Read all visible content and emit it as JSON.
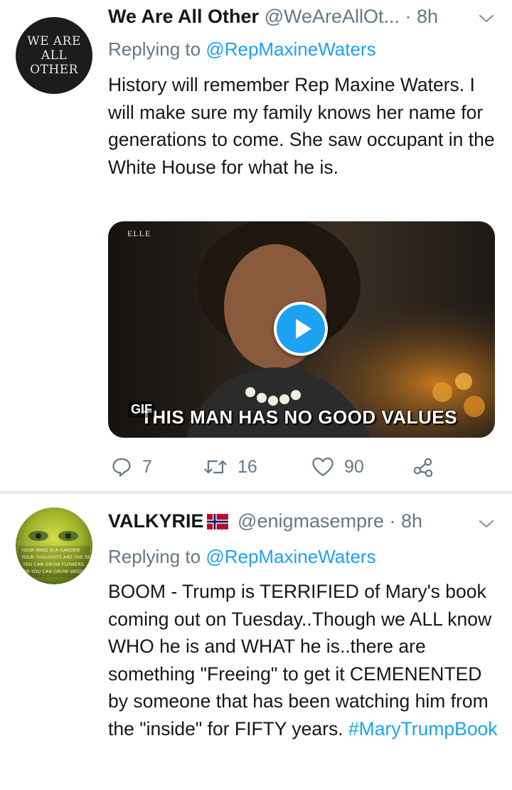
{
  "tweets": [
    {
      "avatar_text": [
        "WE ARE ALL",
        "OTHER"
      ],
      "name": "We Are All Other",
      "handle": "@WeAreAllOt...",
      "time": "· 8h",
      "replying_prefix": "Replying to",
      "replying_to": "@RepMaxineWaters",
      "body": "History will remember Rep Maxine Waters. I will make sure my family knows her name for generations to come. She saw occupant in the White House for what he is.",
      "media": {
        "watermark": "ELLE",
        "badge": "GIF",
        "caption": "THIS MAN HAS NO GOOD VALUES"
      },
      "actions": {
        "replies": "7",
        "retweets": "16",
        "likes": "90"
      }
    },
    {
      "avatar_text": [
        "YOUR MIND IS A GARDEN",
        "YOUR THOUGHTS ARE THE SEEDS",
        "YOU CAN GROW FLOWERS",
        "OR YOU CAN GROW WEEDS"
      ],
      "name": "VALKYRIE",
      "flag_icon": "norway-flag-icon",
      "handle": "@enigmasempre",
      "time": "· 8h",
      "replying_prefix": "Replying to",
      "replying_to": "@RepMaxineWaters",
      "body": "BOOM - Trump is TERRIFIED of Mary's book coming out on Tuesday..Though we ALL know WHO he is and WHAT he is..there are something \"Freeing\" to get it CEMENENTED by someone that has been watching him from the \"inside\" for FIFTY years.",
      "hashtag": "#MaryTrumpBook"
    }
  ],
  "colors": {
    "link": "#1da1f2",
    "muted": "#657786",
    "text": "#14171a",
    "divider": "#e6ecf0"
  }
}
